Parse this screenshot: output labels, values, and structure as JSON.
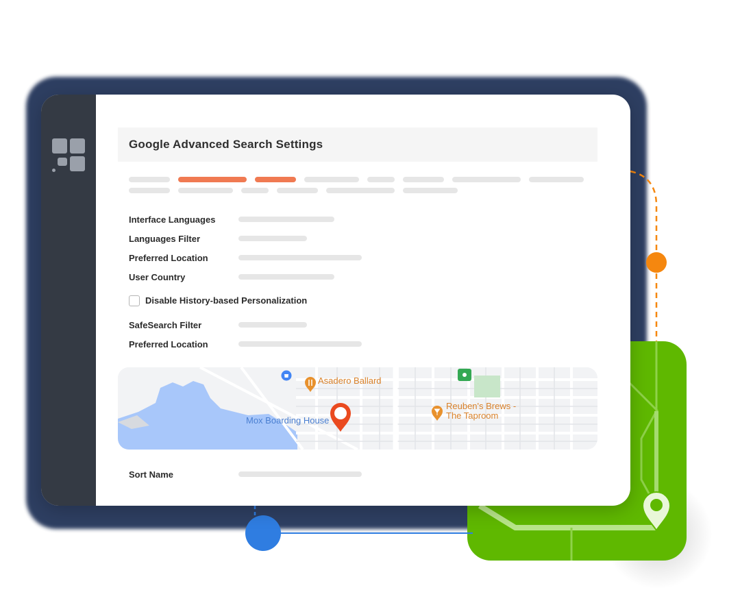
{
  "window": {
    "title": "Google Advanced Search Settings"
  },
  "fields": [
    {
      "label": "Interface Languages"
    },
    {
      "label": "Languages Filter"
    },
    {
      "label": "Preferred Location"
    },
    {
      "label": "User Country"
    }
  ],
  "checkbox": {
    "label": "Disable History-based Personalization",
    "checked": false
  },
  "fields_2": [
    {
      "label": "SafeSearch Filter"
    },
    {
      "label": "Preferred Location"
    }
  ],
  "map": {
    "places": [
      {
        "name": "Asadero Ballard",
        "icon": "restaurant-pin-icon"
      },
      {
        "name": "Mox Boarding House",
        "icon": "location-pin-icon"
      },
      {
        "name": "Reuben's Brews - The Taproom",
        "line1": "Reuben's Brews -",
        "line2": "The Taproom",
        "icon": "bar-pin-icon"
      }
    ],
    "colors": {
      "water": "#a8c7fa",
      "land": "#f2f3f5",
      "pin": "#ea4a1f",
      "label": "#d9822b",
      "water_label": "#4a7fd1"
    }
  },
  "bottom_field": {
    "label": "Sort Name"
  },
  "colors": {
    "accent": "#f07a52",
    "sidebar": "#343a44",
    "green": "#5fb800",
    "orange_dot": "#f5870f",
    "blue_dot": "#2f7de1"
  }
}
